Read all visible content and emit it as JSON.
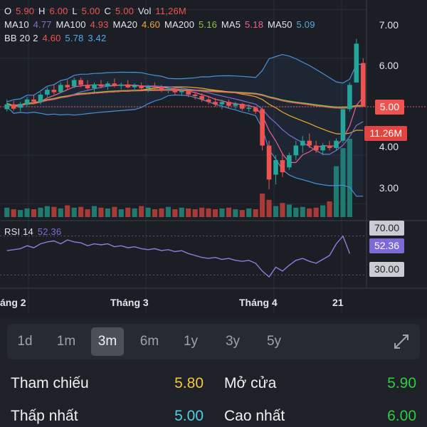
{
  "ohlc": {
    "o_label": "O",
    "o_value": "5.90",
    "h_label": "H",
    "h_value": "6.00",
    "l_label": "L",
    "l_value": "5.00",
    "c_label": "C",
    "c_value": "5.00",
    "vol_label": "Vol",
    "vol_value": "11,26M"
  },
  "ma_legend": {
    "ma10_label": "MA10",
    "ma10_value": "4.77",
    "ma100_label": "MA100",
    "ma100_value": "4.93",
    "ma20_label": "MA20",
    "ma20_value": "4.60",
    "ma200_label": "MA200",
    "ma200_value": "5.16",
    "ma5_label": "MA5",
    "ma5_value": "5.18",
    "ma50_label": "MA50",
    "ma50_value": "5.09"
  },
  "bb_legend": {
    "label": "BB 20 2",
    "v1": "4.60",
    "v2": "5.78",
    "v3": "3.42"
  },
  "rsi_legend": {
    "label": "RSI 14",
    "value": "52.36"
  },
  "price_axis": [
    "7.00",
    "6.00",
    "4.00",
    "3.00"
  ],
  "price_tag": "5.00",
  "volume_tag": "11.26M",
  "rsi_levels": {
    "upper": "70.00",
    "current": "52.36",
    "lower": "30.00"
  },
  "months": [
    "áng 2",
    "Tháng 3",
    "Tháng 4",
    "21"
  ],
  "range_tabs": [
    "1d",
    "1m",
    "3m",
    "6m",
    "1y",
    "3y",
    "5y"
  ],
  "active_range": "3m",
  "stats": {
    "ref_label": "Tham chiếu",
    "ref_value": "5.80",
    "open_label": "Mở cửa",
    "open_value": "5.90",
    "low_label": "Thấp nhất",
    "low_value": "5.00",
    "high_label": "Cao nhất",
    "high_value": "6.00"
  },
  "colors": {
    "up": "#26a69a",
    "down": "#ef5350",
    "ma10": "#7e6fd0",
    "ma100": "#ef5350",
    "ma20": "#f0a830",
    "ma200": "#8bc34a",
    "ma5": "#f06292",
    "ma50": "#5aa9e6",
    "bb": "#4a90d9",
    "rsi": "#8a7fe0",
    "ref": "#f5c542",
    "open": "#2ecc40",
    "low": "#4dd0e1",
    "high": "#2ecc40"
  },
  "chart_data": {
    "type": "candlestick",
    "price_ylim": [
      2.8,
      7.2
    ],
    "candles": [
      {
        "o": 4.95,
        "h": 5.15,
        "l": 4.9,
        "c": 5.05
      },
      {
        "o": 5.05,
        "h": 5.12,
        "l": 4.92,
        "c": 4.96
      },
      {
        "o": 4.98,
        "h": 5.1,
        "l": 4.9,
        "c": 5.06
      },
      {
        "o": 5.05,
        "h": 5.2,
        "l": 5.0,
        "c": 5.15
      },
      {
        "o": 5.15,
        "h": 5.25,
        "l": 5.05,
        "c": 5.1
      },
      {
        "o": 5.1,
        "h": 5.3,
        "l": 5.05,
        "c": 5.25
      },
      {
        "o": 5.25,
        "h": 5.4,
        "l": 5.2,
        "c": 5.35
      },
      {
        "o": 5.35,
        "h": 5.45,
        "l": 5.25,
        "c": 5.3
      },
      {
        "o": 5.3,
        "h": 5.5,
        "l": 5.28,
        "c": 5.45
      },
      {
        "o": 5.45,
        "h": 5.55,
        "l": 5.35,
        "c": 5.4
      },
      {
        "o": 5.42,
        "h": 5.6,
        "l": 5.38,
        "c": 5.55
      },
      {
        "o": 5.55,
        "h": 5.6,
        "l": 5.4,
        "c": 5.45
      },
      {
        "o": 5.45,
        "h": 5.55,
        "l": 5.35,
        "c": 5.38
      },
      {
        "o": 5.38,
        "h": 5.5,
        "l": 5.3,
        "c": 5.46
      },
      {
        "o": 5.46,
        "h": 5.55,
        "l": 5.38,
        "c": 5.42
      },
      {
        "o": 5.42,
        "h": 5.52,
        "l": 5.35,
        "c": 5.48
      },
      {
        "o": 5.48,
        "h": 5.58,
        "l": 5.4,
        "c": 5.43
      },
      {
        "o": 5.43,
        "h": 5.5,
        "l": 5.36,
        "c": 5.46
      },
      {
        "o": 5.46,
        "h": 5.55,
        "l": 5.38,
        "c": 5.4
      },
      {
        "o": 5.4,
        "h": 5.48,
        "l": 5.33,
        "c": 5.44
      },
      {
        "o": 5.44,
        "h": 5.5,
        "l": 5.35,
        "c": 5.38
      },
      {
        "o": 5.38,
        "h": 5.45,
        "l": 5.3,
        "c": 5.42
      },
      {
        "o": 5.42,
        "h": 5.5,
        "l": 5.36,
        "c": 5.4
      },
      {
        "o": 5.4,
        "h": 5.45,
        "l": 5.3,
        "c": 5.35
      },
      {
        "o": 5.35,
        "h": 5.42,
        "l": 5.28,
        "c": 5.37
      },
      {
        "o": 5.37,
        "h": 5.4,
        "l": 5.25,
        "c": 5.3
      },
      {
        "o": 5.3,
        "h": 5.38,
        "l": 5.22,
        "c": 5.33
      },
      {
        "o": 5.33,
        "h": 5.36,
        "l": 5.2,
        "c": 5.25
      },
      {
        "o": 5.25,
        "h": 5.3,
        "l": 5.15,
        "c": 5.22
      },
      {
        "o": 5.22,
        "h": 5.28,
        "l": 5.1,
        "c": 5.15
      },
      {
        "o": 5.15,
        "h": 5.22,
        "l": 5.05,
        "c": 5.1
      },
      {
        "o": 5.1,
        "h": 5.18,
        "l": 5.0,
        "c": 5.05
      },
      {
        "o": 5.05,
        "h": 5.15,
        "l": 4.95,
        "c": 5.1
      },
      {
        "o": 5.1,
        "h": 5.15,
        "l": 4.98,
        "c": 5.02
      },
      {
        "o": 5.02,
        "h": 5.1,
        "l": 4.95,
        "c": 5.06
      },
      {
        "o": 5.06,
        "h": 5.08,
        "l": 4.92,
        "c": 4.96
      },
      {
        "o": 4.96,
        "h": 5.05,
        "l": 4.9,
        "c": 4.98
      },
      {
        "o": 4.98,
        "h": 5.0,
        "l": 4.85,
        "c": 4.9
      },
      {
        "o": 4.95,
        "h": 4.98,
        "l": 4.1,
        "c": 4.2
      },
      {
        "o": 4.2,
        "h": 4.3,
        "l": 3.3,
        "c": 3.5
      },
      {
        "o": 3.6,
        "h": 4.0,
        "l": 3.4,
        "c": 3.9
      },
      {
        "o": 3.9,
        "h": 4.05,
        "l": 3.55,
        "c": 3.65
      },
      {
        "o": 3.75,
        "h": 4.05,
        "l": 3.7,
        "c": 4.0
      },
      {
        "o": 4.0,
        "h": 4.3,
        "l": 3.9,
        "c": 4.2
      },
      {
        "o": 4.2,
        "h": 4.4,
        "l": 4.05,
        "c": 4.3
      },
      {
        "o": 4.3,
        "h": 4.45,
        "l": 4.15,
        "c": 4.2
      },
      {
        "o": 4.2,
        "h": 4.3,
        "l": 4.05,
        "c": 4.1
      },
      {
        "o": 4.1,
        "h": 4.25,
        "l": 4.0,
        "c": 4.2
      },
      {
        "o": 4.2,
        "h": 4.3,
        "l": 4.1,
        "c": 4.15
      },
      {
        "o": 4.15,
        "h": 4.35,
        "l": 4.1,
        "c": 4.3
      },
      {
        "o": 4.3,
        "h": 4.8,
        "l": 4.25,
        "c": 4.95
      },
      {
        "o": 4.95,
        "h": 5.5,
        "l": 4.9,
        "c": 5.45
      },
      {
        "o": 5.5,
        "h": 6.4,
        "l": 5.5,
        "c": 6.3
      },
      {
        "o": 5.9,
        "h": 6.0,
        "l": 5.0,
        "c": 5.0
      }
    ],
    "volume": [
      12,
      10,
      9,
      11,
      10,
      12,
      14,
      13,
      11,
      15,
      12,
      13,
      10,
      14,
      12,
      11,
      13,
      10,
      12,
      11,
      14,
      12,
      10,
      11,
      13,
      10,
      12,
      11,
      10,
      12,
      11,
      10,
      11,
      12,
      10,
      9,
      11,
      10,
      30,
      22,
      14,
      18,
      16,
      12,
      13,
      11,
      12,
      15,
      20,
      65,
      88,
      100
    ],
    "rsi": [
      55,
      56,
      57,
      60,
      58,
      62,
      64,
      65,
      62,
      66,
      64,
      63,
      60,
      62,
      61,
      62,
      59,
      60,
      58,
      59,
      57,
      56,
      57,
      55,
      56,
      54,
      55,
      52,
      50,
      48,
      47,
      48,
      46,
      47,
      45,
      44,
      45,
      42,
      34,
      28,
      38,
      34,
      40,
      45,
      47,
      44,
      42,
      46,
      50,
      62,
      70,
      52
    ],
    "rsi_ylim": [
      20,
      80
    ],
    "rsi_levels": [
      70,
      30
    ]
  }
}
